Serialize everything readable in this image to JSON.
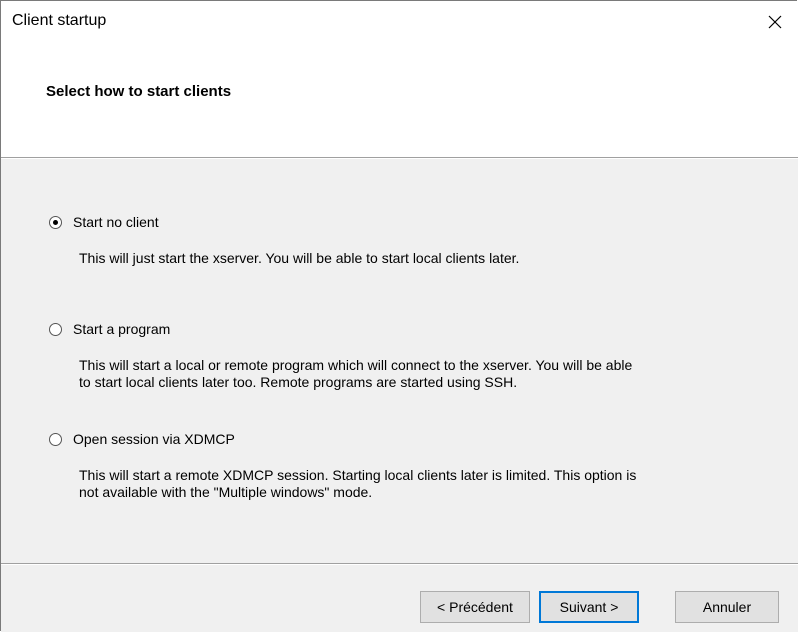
{
  "window": {
    "title": "Client startup"
  },
  "header": {
    "title": "Select how to start clients"
  },
  "options": [
    {
      "label": "Start no client",
      "checked": true,
      "description_lines": [
        "This will just start the xserver. You will be able to start local clients later."
      ]
    },
    {
      "label": "Start a program",
      "checked": false,
      "description_lines": [
        "This will start a local or remote program which will connect to the xserver. You will be able",
        "to start local clients later too. Remote programs are started using SSH."
      ]
    },
    {
      "label": "Open session via XDMCP",
      "checked": false,
      "description_lines": [
        "This will start a remote XDMCP session. Starting local clients later is limited. This option is",
        "not available with the \"Multiple windows\" mode."
      ]
    }
  ],
  "buttons": {
    "back": "< Précédent",
    "next": "Suivant >",
    "cancel": "Annuler"
  },
  "icons": {
    "close": "close-icon"
  }
}
